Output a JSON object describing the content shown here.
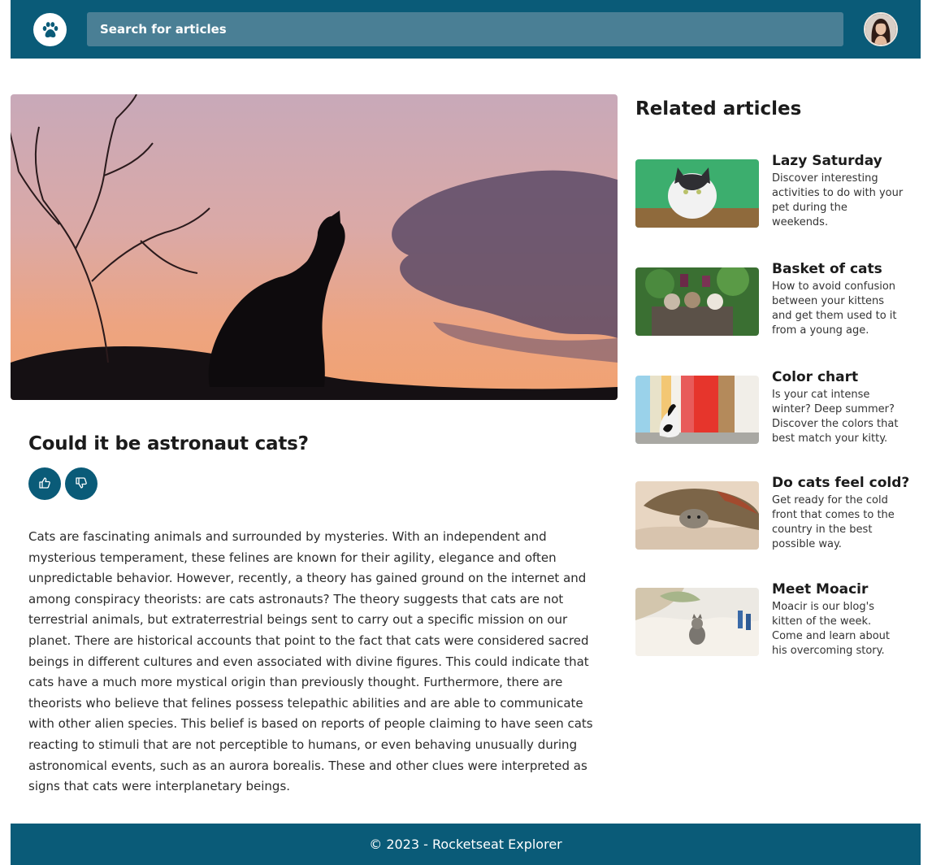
{
  "header": {
    "logo_icon": "paw-icon",
    "search_placeholder": "Search for articles",
    "avatar_icon": "user-avatar"
  },
  "article": {
    "title": "Could it be astronaut cats?",
    "like_icon": "thumbs-up-icon",
    "dislike_icon": "thumbs-down-icon",
    "body": "Cats are fascinating animals and surrounded by mysteries. With an independent and mysterious temperament, these felines are known for their agility, elegance and often unpredictable behavior. However, recently, a theory has gained ground on the internet and among conspiracy theorists: are cats astronauts? The theory suggests that cats are not terrestrial animals, but extraterrestrial beings sent to carry out a specific mission on our planet. There are historical accounts that point to the fact that cats were considered sacred beings in different cultures and even associated with divine figures. This could indicate that cats have a much more mystical origin than previously thought. Furthermore, there are theorists who believe that felines possess telepathic abilities and are able to communicate with other alien species. This belief is based on reports of people claiming to have seen cats reacting to stimuli that are not perceptible to humans, or even behaving unusually during astronomical events, such as an aurora borealis. These and other clues were interpreted as signs that cats were interplanetary beings."
  },
  "related": {
    "heading": "Related articles",
    "items": [
      {
        "title": "Lazy Saturday",
        "description": "Discover interesting activities to do with your pet during the weekends."
      },
      {
        "title": "Basket of cats",
        "description": "How to avoid confusion between your kittens and get them used to it from a young age."
      },
      {
        "title": "Color chart",
        "description": "Is your cat intense winter? Deep summer? Discover the colors that best match your kitty."
      },
      {
        "title": "Do cats feel cold?",
        "description": "Get ready for the cold front that comes to the country in the best possible way."
      },
      {
        "title": "Meet Moacir",
        "description": "Moacir is our blog's kitten of the week. Come and learn about his overcoming story."
      }
    ]
  },
  "footer": {
    "text": "© 2023 - Rocketseat Explorer"
  },
  "colors": {
    "primary": "#0a5b78",
    "search_bg": "#4a7f95"
  }
}
